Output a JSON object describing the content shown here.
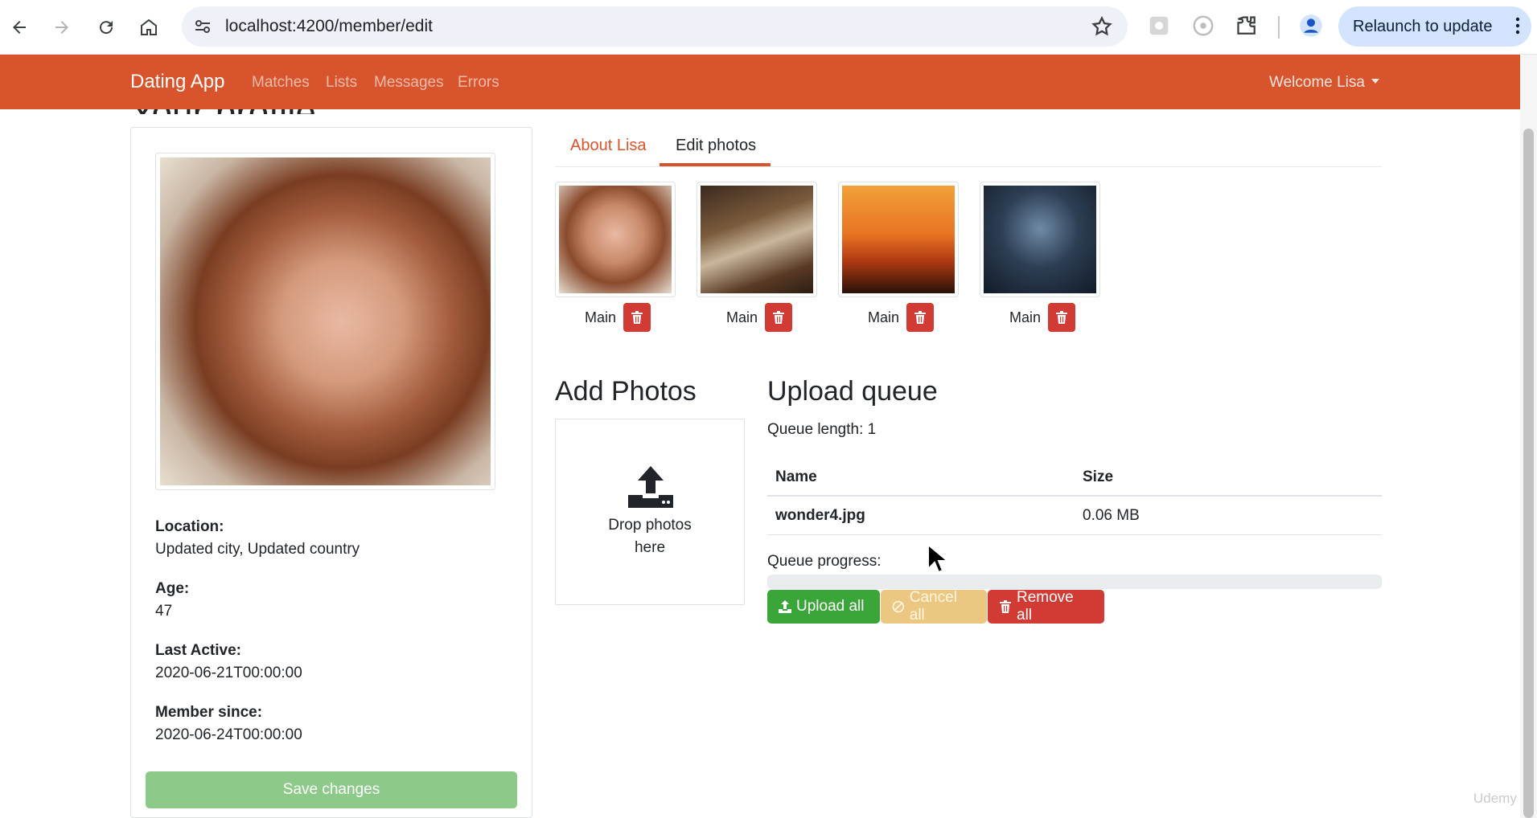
{
  "browser": {
    "url": "localhost:4200/member/edit",
    "relaunch_label": "Relaunch to update"
  },
  "navbar": {
    "brand": "Dating App",
    "links": [
      "Matches",
      "Lists",
      "Messages",
      "Errors"
    ],
    "welcome": "Welcome Lisa",
    "color": "#d8542c"
  },
  "page": {
    "heading": "Your profile"
  },
  "profile": {
    "location_label": "Location:",
    "location_value": "Updated city, Updated country",
    "age_label": "Age:",
    "age_value": "47",
    "last_active_label": "Last Active:",
    "last_active_value": "2020-06-21T00:00:00",
    "member_since_label": "Member since:",
    "member_since_value": "2020-06-24T00:00:00",
    "save_label": "Save changes"
  },
  "tabs": {
    "about": "About Lisa",
    "edit": "Edit photos",
    "active": "edit"
  },
  "photos": [
    {
      "main_label": "Main"
    },
    {
      "main_label": "Main"
    },
    {
      "main_label": "Main"
    },
    {
      "main_label": "Main"
    }
  ],
  "add_photos": {
    "title": "Add Photos",
    "drop_text_line1": "Drop photos",
    "drop_text_line2": "here"
  },
  "upload_queue": {
    "title": "Upload queue",
    "queue_length": "Queue length: 1",
    "columns": [
      "Name",
      "Size"
    ],
    "rows": [
      {
        "name": "wonder4.jpg",
        "size": "0.06 MB"
      }
    ],
    "progress_label": "Queue progress:",
    "progress_fraction": 0,
    "upload_all": "Upload all",
    "cancel_all": "Cancel all",
    "remove_all": "Remove all"
  },
  "watermark": "Udemy"
}
